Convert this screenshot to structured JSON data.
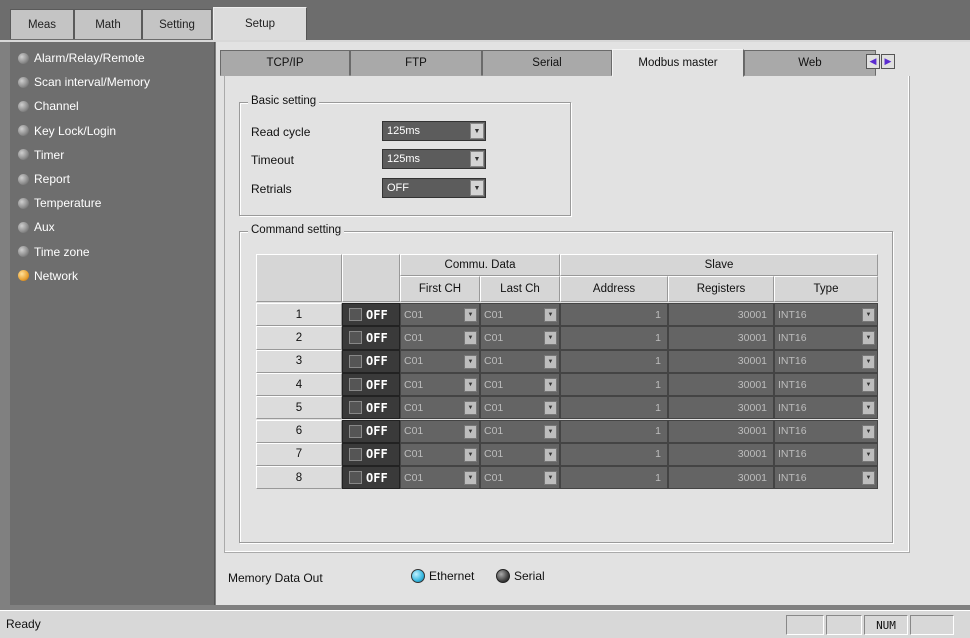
{
  "top_tabs": [
    {
      "label": "Meas"
    },
    {
      "label": "Math"
    },
    {
      "label": "Setting"
    },
    {
      "label": "Setup"
    }
  ],
  "sidebar": {
    "items": [
      {
        "label": "Alarm/Relay/Remote"
      },
      {
        "label": "Scan interval/Memory"
      },
      {
        "label": "Channel"
      },
      {
        "label": "Key Lock/Login"
      },
      {
        "label": "Timer"
      },
      {
        "label": "Report"
      },
      {
        "label": "Temperature"
      },
      {
        "label": "Aux"
      },
      {
        "label": "Time zone"
      },
      {
        "label": "Network"
      }
    ],
    "active": "Network"
  },
  "sub_tabs": [
    {
      "label": "TCP/IP"
    },
    {
      "label": "FTP"
    },
    {
      "label": "Serial"
    },
    {
      "label": "Modbus master"
    },
    {
      "label": "Web"
    }
  ],
  "basic": {
    "title": "Basic setting",
    "read_cycle_label": "Read cycle",
    "read_cycle_value": "125ms",
    "timeout_label": "Timeout",
    "timeout_value": "125ms",
    "retrials_label": "Retrials",
    "retrials_value": "OFF"
  },
  "command": {
    "title": "Command setting",
    "group_commu": "Commu. Data",
    "group_slave": "Slave",
    "col_first": "First CH",
    "col_last": "Last Ch",
    "col_address": "Address",
    "col_registers": "Registers",
    "col_type": "Type",
    "rows": [
      {
        "no": "1",
        "state": "OFF",
        "first": "C01",
        "last": "C01",
        "address": "1",
        "registers": "30001",
        "type": "INT16"
      },
      {
        "no": "2",
        "state": "OFF",
        "first": "C01",
        "last": "C01",
        "address": "1",
        "registers": "30001",
        "type": "INT16"
      },
      {
        "no": "3",
        "state": "OFF",
        "first": "C01",
        "last": "C01",
        "address": "1",
        "registers": "30001",
        "type": "INT16"
      },
      {
        "no": "4",
        "state": "OFF",
        "first": "C01",
        "last": "C01",
        "address": "1",
        "registers": "30001",
        "type": "INT16"
      },
      {
        "no": "5",
        "state": "OFF",
        "first": "C01",
        "last": "C01",
        "address": "1",
        "registers": "30001",
        "type": "INT16"
      },
      {
        "no": "6",
        "state": "OFF",
        "first": "C01",
        "last": "C01",
        "address": "1",
        "registers": "30001",
        "type": "INT16"
      },
      {
        "no": "7",
        "state": "OFF",
        "first": "C01",
        "last": "C01",
        "address": "1",
        "registers": "30001",
        "type": "INT16"
      },
      {
        "no": "8",
        "state": "OFF",
        "first": "C01",
        "last": "C01",
        "address": "1",
        "registers": "30001",
        "type": "INT16"
      }
    ]
  },
  "memory_out": {
    "label": "Memory Data Out",
    "option_ethernet": "Ethernet",
    "option_serial": "Serial"
  },
  "status_bar": {
    "text": "Ready",
    "num": "NUM"
  },
  "colors": {
    "active_dot": "#e8a030",
    "ethernet_radio": "#37b8e0"
  }
}
